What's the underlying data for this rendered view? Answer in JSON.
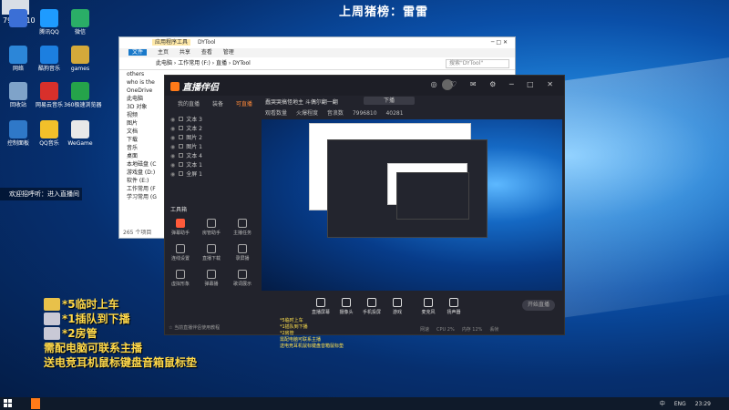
{
  "stream": {
    "title": "上周猪榜：雷雷",
    "viewer_count": "7996810"
  },
  "desktop_icons": [
    {
      "label": "",
      "icon": "app-icon",
      "color": "#3b6fd6"
    },
    {
      "label": "腾讯QQ",
      "icon": "qq-icon",
      "color": "#1e9bff"
    },
    {
      "label": "微信",
      "icon": "wechat-icon",
      "color": "#2aae67"
    },
    {
      "label": "网络",
      "icon": "network-icon",
      "color": "#2c86d8"
    },
    {
      "label": "酷狗音乐",
      "icon": "kugou-icon",
      "color": "#1c7fe0"
    },
    {
      "label": "games",
      "icon": "folder-icon",
      "color": "#d4a93a"
    },
    {
      "label": "回收站",
      "icon": "recycle-bin-icon",
      "color": "#7fa3c9"
    },
    {
      "label": "网易云音乐",
      "icon": "netease-music-icon",
      "color": "#d8302b"
    },
    {
      "label": "360极速浏览器",
      "icon": "browser-icon",
      "color": "#25a34a"
    },
    {
      "label": "控制面板",
      "icon": "control-panel-icon",
      "color": "#2f78c8"
    },
    {
      "label": "QQ音乐",
      "icon": "qq-music-icon",
      "color": "#f2c02a"
    },
    {
      "label": "WeGame",
      "icon": "wegame-icon",
      "color": "#e8e8e8"
    }
  ],
  "desktop_hint": "欢迎招呼听：进入直播间",
  "explorer": {
    "title": "DYTool",
    "ribbon_tabs": [
      "文件",
      "主页",
      "共享",
      "查看",
      "管理"
    ],
    "context_tab": "应用程序工具",
    "address": "此电脑 › 工作常用 (F:) › 直播 › DYTool",
    "search_placeholder": "搜索\"DYTool\"",
    "nav_items": [
      "others",
      "who is the",
      "OneDrive",
      "此电脑",
      "3D 对象",
      "视频",
      "图片",
      "文档",
      "下载",
      "音乐",
      "桌面",
      "本地磁盘 (C",
      "游戏盘 (D:)",
      "软件 (E:)",
      "工作常用 (F",
      "学习常用 (G"
    ],
    "status": "265 个项目"
  },
  "app": {
    "name": "直播伴侣",
    "tabs": [
      "我的直播",
      "装备",
      "可直播"
    ],
    "active_tab": "可直播",
    "room_title": "蠢哭哭搞怪地主 斗偶尔翻一翻",
    "room_button": "下播",
    "room_meta": [
      "观看数量",
      "火爆程度",
      "音浪数",
      "7996810",
      "40281"
    ],
    "header_controls": "◎ ♡ ✉ ⚙ ─ □ ✕",
    "scenes": [
      {
        "label": "文本 3"
      },
      {
        "label": "文本 2"
      },
      {
        "label": "图片 2"
      },
      {
        "label": "图片 1"
      },
      {
        "label": "文本 4"
      },
      {
        "label": "文本 1"
      },
      {
        "label": "全屏 1"
      }
    ],
    "tools_title": "工具箱",
    "tools": [
      {
        "label": "弹幕助手",
        "hot": true
      },
      {
        "label": "房管助手",
        "hot": false
      },
      {
        "label": "主播任务",
        "hot": false
      },
      {
        "label": "连线设置",
        "hot": false
      },
      {
        "label": "直播下载",
        "hot": false
      },
      {
        "label": "录屏播",
        "hot": false
      },
      {
        "label": "虚拟形象",
        "hot": false
      },
      {
        "label": "弹幕播",
        "hot": false
      },
      {
        "label": "歌词展示",
        "hot": false
      }
    ],
    "footer_text": "☆ 当前直播伴侣使用教程",
    "preview_notes": [
      "*5临时上车",
      "*1插队到下播",
      "*2房管",
      "需配电脑可联系主播",
      "送电竞耳机鼠标键盘音箱鼠标垫"
    ],
    "controls": [
      {
        "label": "直播屏幕",
        "icon": "screen-icon"
      },
      {
        "label": "摄像头",
        "icon": "camera-icon"
      },
      {
        "label": "手机投屏",
        "icon": "phone-icon"
      },
      {
        "label": "游戏",
        "icon": "game-icon"
      },
      {
        "label": "麦克风",
        "icon": "mic-icon"
      },
      {
        "label": "扬声器",
        "icon": "speaker-icon"
      }
    ],
    "start_button": "开始直播",
    "perf": [
      "网速",
      "CPU 2%",
      "内存 12%",
      "丢帧"
    ]
  },
  "notice": {
    "lines": [
      {
        "text": "*5临时上车",
        "badge": "#e8c14a"
      },
      {
        "text": "*1插队到下播",
        "badge": "#c9c9d6"
      },
      {
        "text": "*2房管",
        "badge": "#c9c9d6"
      },
      {
        "text": "需配电脑可联系主播",
        "badge": ""
      },
      {
        "text": "送电竞耳机鼠标键盘音箱鼠标垫",
        "badge": ""
      }
    ]
  },
  "taskbar": {
    "language": "ENG",
    "ime": "中",
    "time": "23:29"
  },
  "colors": {
    "accent": "#ff7a18",
    "notice": "#ffd94a"
  }
}
